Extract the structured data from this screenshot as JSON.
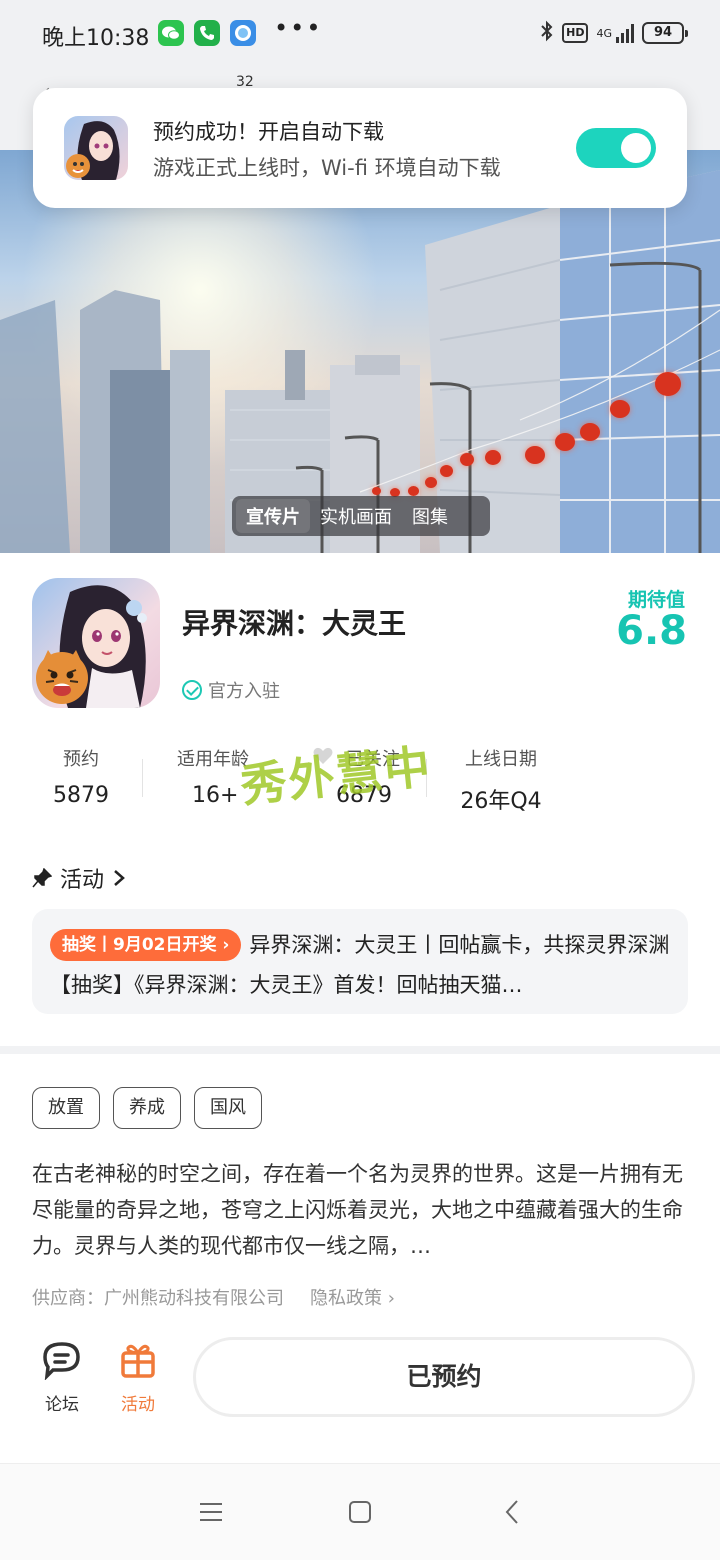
{
  "status_bar": {
    "time": "晚上10:38",
    "hd": "HD",
    "network": "4G",
    "battery": "94"
  },
  "header": {
    "count": "32"
  },
  "toast": {
    "title": "预约成功！开启自动下载",
    "subtitle": "游戏正式上线时，Wi-fi 环境自动下载",
    "auto_download_enabled": true
  },
  "hero": {
    "tabs": [
      "宣传片",
      "实机画面",
      "图集"
    ],
    "active_tab": 0
  },
  "game": {
    "title": "异界深渊：大灵王",
    "official": "官方入驻",
    "expect_label": "期待值",
    "expect_value": "6.8"
  },
  "stats": [
    {
      "label": "预约",
      "value": "5879"
    },
    {
      "label": "适用年龄",
      "value": "16+"
    },
    {
      "label": "已关注",
      "value": "6879"
    },
    {
      "label": "上线日期",
      "value": "26年Q4"
    }
  ],
  "watermark": "秀外慧中",
  "activity": {
    "header": "活动",
    "badge": "抽奖丨9月02日开奖 ›",
    "text": "异界深渊：大灵王丨回帖赢卡，共探灵界深渊【抽奖】《异界深渊：大灵王》首发！回帖抽天猫…"
  },
  "tags": [
    "放置",
    "养成",
    "国风"
  ],
  "description": "在古老神秘的时空之间，存在着一个名为灵界的世界。这是一片拥有无尽能量的奇异之地，苍穹之上闪烁着灵光，大地之中蕴藏着强大的生命力。灵界与人类的现代都市仅一线之隔，…",
  "supplier": {
    "text": "供应商：广州熊动科技有限公司",
    "privacy": "隐私政策"
  },
  "bottom": {
    "forum": "论坛",
    "activity": "活动",
    "reserved": "已预约"
  },
  "colors": {
    "accent": "#17c4b2",
    "toggle": "#1dd4be",
    "badge": "#fe6c3a",
    "activity_icon": "#f07a3a"
  }
}
